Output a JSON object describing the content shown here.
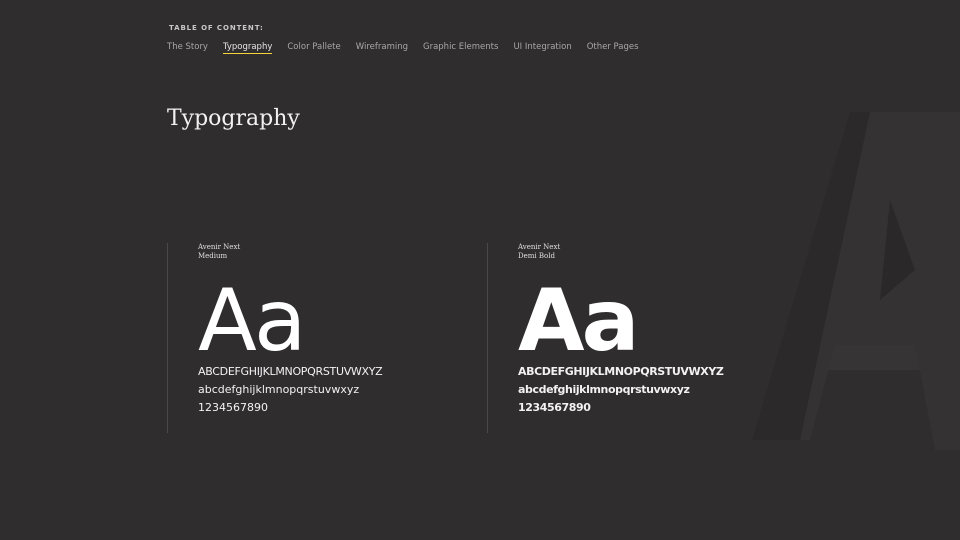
{
  "toc": {
    "label": "TABLE OF CONTENT:",
    "items": [
      {
        "label": "The Story",
        "active": false
      },
      {
        "label": "Typography",
        "active": true
      },
      {
        "label": "Color Pallete",
        "active": false
      },
      {
        "label": "Wireframing",
        "active": false
      },
      {
        "label": "Graphic Elements",
        "active": false
      },
      {
        "label": "UI Integration",
        "active": false
      },
      {
        "label": "Other Pages",
        "active": false
      }
    ]
  },
  "page": {
    "title": "Typography"
  },
  "specimens": [
    {
      "family": "Avenir Next",
      "weight": "Medium",
      "sample": "Aa",
      "uppercase": "ABCDEFGHIJKLMNOPQRSTUVWXYZ",
      "lowercase": "abcdefghijklmnopqrstuvwxyz",
      "digits": "1234567890"
    },
    {
      "family": "Avenir Next",
      "weight": "Demi Bold",
      "sample": "Aa",
      "uppercase": "ABCDEFGHIJKLMNOPQRSTUVWXYZ",
      "lowercase": "abcdefghijklmnopqrstuvwxyz",
      "digits": "1234567890"
    }
  ],
  "colors": {
    "background": "#2f2d2e",
    "accent_underline": "#f5d33a"
  }
}
